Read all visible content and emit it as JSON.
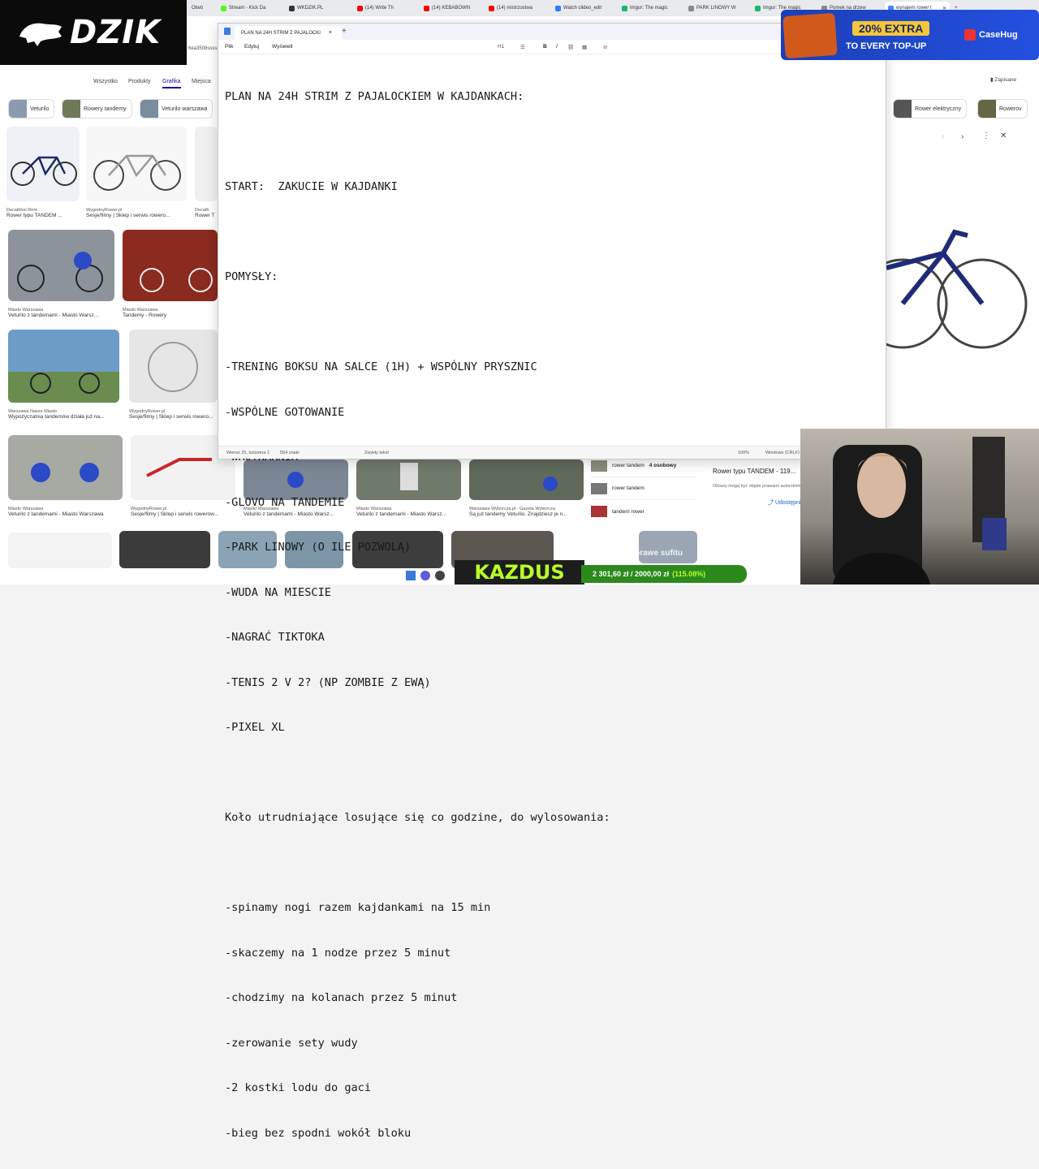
{
  "browser": {
    "tabs": [
      {
        "label": "Stream - Kick Da",
        "color": "#53fc18"
      },
      {
        "label": "WKDZIK.PL",
        "color": "#333333"
      },
      {
        "label": "(14) Write Th",
        "color": "#ff0000"
      },
      {
        "label": "(14) KEBABOWN",
        "color": "#ff0000"
      },
      {
        "label": "(14) mistrzostwa",
        "color": "#ff0000"
      },
      {
        "label": "Watch clideo_edit",
        "color": "#2b7cff"
      },
      {
        "label": "Imgur: The magic",
        "color": "#1bb76e"
      },
      {
        "label": "PARK LINOWY W",
        "color": "#888888"
      },
      {
        "label": "Imgur: The magic",
        "color": "#1bb76e"
      },
      {
        "label": "Pomek na drzew",
        "color": "#888888"
      },
      {
        "label": "wynajem rower t",
        "color": "#4285f4"
      }
    ],
    "url_fragment": "6ea3508ssssrl"
  },
  "google": {
    "filters": [
      "Wszystko",
      "Produkty",
      "Grafika",
      "Miejsca"
    ],
    "active_filter": "Grafika",
    "chips": [
      "Veturilo",
      "Rowery tandemy",
      "Veturilo warszawa"
    ],
    "right_chips": [
      "Rower elektryczny",
      "Rowerov"
    ],
    "saved_label": "Zapisane",
    "cards": [
      {
        "source": "Decathlon Rent",
        "caption": "Rower typu TANDEM ..."
      },
      {
        "source": "WygodnyRower.pl",
        "caption": "Sesje/filmy | Sklep i serwis rowero..."
      },
      {
        "source": "Decath",
        "caption": "Rower T"
      },
      {
        "source": "Miasto Warszawa",
        "caption": "Veturilo z tandemami - Miasto Warsz..."
      },
      {
        "source": "Miasto Warszawa",
        "caption": "Tandemy - Rowery"
      },
      {
        "source": "Warszawa Nasze Miasto",
        "caption": "Wypożyczalnia tandemów działa już na..."
      },
      {
        "source": "WygodnyRower.pl",
        "caption": "Sesje/filmy | Sklep i serwis rowero..."
      },
      {
        "source": "Miasto Warszawa",
        "caption": "Veturilo z tandemami - Miasto Warszawa"
      },
      {
        "source": "WygodnyRower.pl",
        "caption": "Sesje/filmy | Sklep i serwis rowerow..."
      },
      {
        "source": "Miasto Warszawa",
        "caption": "Veturilo z tandemami - Miasto Warsz..."
      },
      {
        "source": "Miasto Warszawa",
        "caption": "Veturilo z tandemami - Miasto Warsz..."
      },
      {
        "source": "Warszawa Wyborcza.pl - Gazeta Wyborcza",
        "caption": "Są już tandemy Veturilo. Znajdziesz je n..."
      }
    ],
    "related": [
      {
        "label": "rower tandem",
        "bold": "4 osobowy"
      },
      {
        "label": "rower tandem",
        "bold": ""
      },
      {
        "label": "tandem rower",
        "bold": ""
      }
    ],
    "right_panel": {
      "title": "Rower typu TANDEM - 119...",
      "note": "Obrazy mogą być objęte prawami autorskimi",
      "share": "Udostępnij"
    }
  },
  "overlays": {
    "logo_text": "DZIK",
    "ad": {
      "line1": "20% EXTRA",
      "line2": "TO EVERY TOP-UP",
      "brand": "CaseHug"
    },
    "name": "KAZDUS",
    "goal": {
      "text": "2 301,60 zł / 2000,00 zł",
      "percent": "(115.08%)",
      "progress": 1.1508
    },
    "caption": "na naprawe sufitu"
  },
  "notepad": {
    "tab_title": "PLAN NA 24H STRIM Z PAJALOCKI",
    "menu": [
      "Plik",
      "Edytuj",
      "Wyświetl"
    ],
    "heading_style": "H1",
    "lines": [
      "PLAN NA 24H STRIM Z PAJALOCKIEM W KAJDANKACH:",
      "",
      "START:  ZAKUCIE W KAJDANKI",
      "",
      "POMYSŁY:",
      "",
      "-TRENING BOKSU NA SALCE (1H) + WSPÓLNY PRYSZNIC",
      "-WSPÓLNE GOTOWANIE",
      "-WROTKARNIA",
      "-GLOVO NA TANDEMIE",
      "-PARK LINOWY (O ILE POZWOLĄ)",
      "-WUDA NA MIESCIE",
      "-NAGRAĆ TIKTOKA",
      "-TENIS 2 V 2? (NP ZOMBIE Z EWĄ)",
      "-PIXEL XL",
      "",
      "Koło utrudniające losujące się co godzine, do wylosowania:",
      "",
      "-spinamy nogi razem kajdankami na 15 min",
      "-skaczemy na 1 nodze przez 5 minut",
      "-chodzimy na kolanach przez 5 minut",
      "-zerowanie sety wudy",
      "-2 kostki lodu do gaci",
      "-bieg bez spodni wokół bloku"
    ],
    "status": {
      "position": "Wiersz 25, kolumna 1",
      "chars": "554 znaki",
      "format": "Zwykły tekst",
      "zoom": "100%",
      "eol": "Windows (CRLF)"
    }
  }
}
